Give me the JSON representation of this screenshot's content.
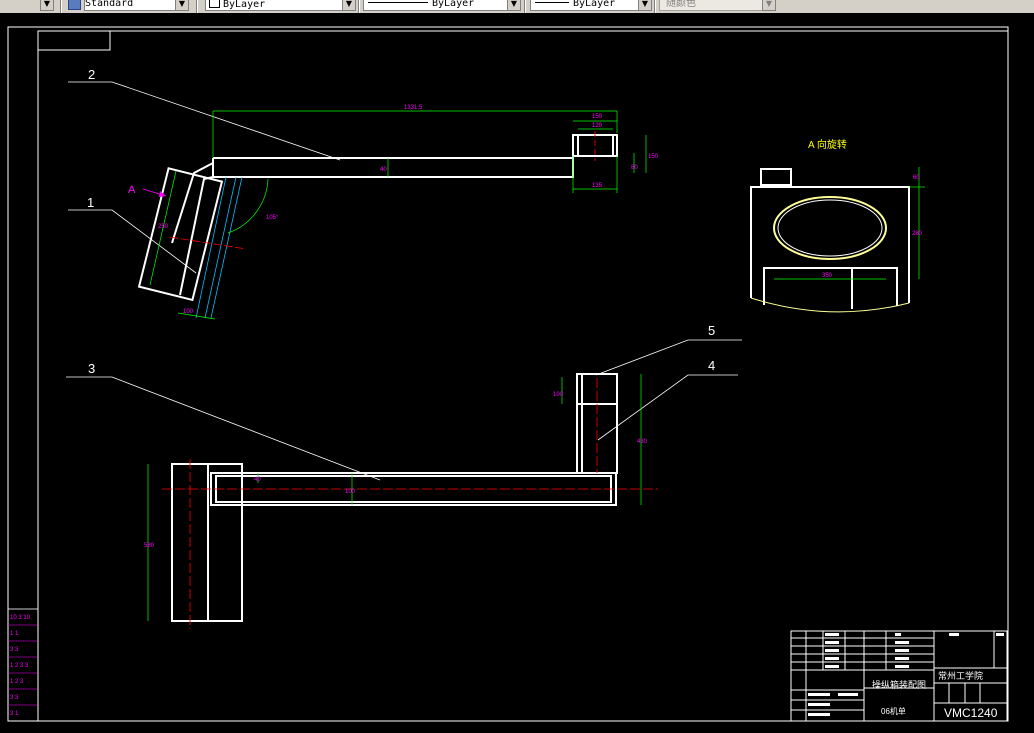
{
  "toolbar": {
    "text_style": "Standard",
    "color": "ByLayer",
    "linetype": "ByLayer",
    "lineweight": "ByLayer",
    "plot_style": "随颜色"
  },
  "drawing": {
    "labels": [
      "1",
      "2",
      "3",
      "4",
      "5"
    ],
    "view_a_letter": "A",
    "view_a_title": "A 向旋转",
    "dims": {
      "len_top": "1331.5",
      "w150": "150",
      "w120": "120",
      "w135": "135",
      "h150": "150",
      "h80": "80",
      "h40": "40",
      "angle": "105°",
      "d100": "100",
      "d250": "250",
      "a60": "60",
      "a280": "280",
      "a350": "350",
      "b100": "100",
      "b430": "430",
      "b40": "40",
      "b100s": "100",
      "b580": "580"
    }
  },
  "title_block": {
    "school": "常州工学院",
    "drawing_name": "操纵箱装配图",
    "class_name": "06机单",
    "drawing_no": "VMC1240"
  },
  "left_strip": [
    "10 3 10",
    "1   1",
    "3   3",
    "1 2 3 3",
    "1 2 3",
    "3   3",
    "3   1"
  ]
}
